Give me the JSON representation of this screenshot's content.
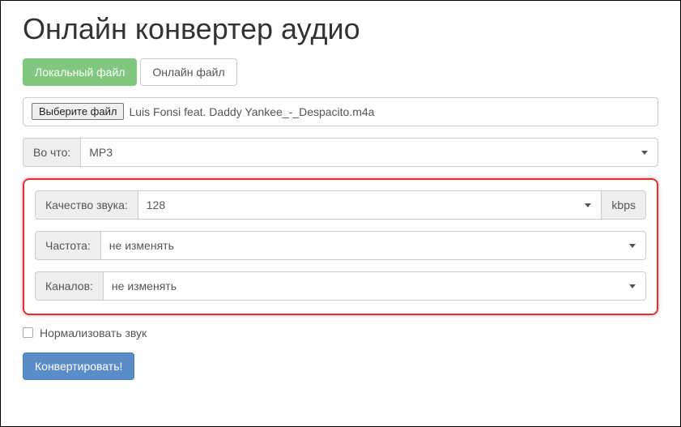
{
  "title": "Онлайн конвертер аудио",
  "tabs": {
    "local": "Локальный файл",
    "online": "Онлайн файл"
  },
  "file": {
    "choose_label": "Выберите файл",
    "filename": "Luis Fonsi feat. Daddy Yankee_-_Despacito.m4a"
  },
  "target": {
    "label": "Во что:",
    "value": "MP3"
  },
  "quality": {
    "label": "Качество звука:",
    "value": "128",
    "unit": "kbps"
  },
  "frequency": {
    "label": "Частота:",
    "value": "не изменять"
  },
  "channels": {
    "label": "Каналов:",
    "value": "не изменять"
  },
  "normalize": {
    "label": "Нормализовать звук",
    "checked": false
  },
  "convert": {
    "label": "Конвертировать!"
  }
}
